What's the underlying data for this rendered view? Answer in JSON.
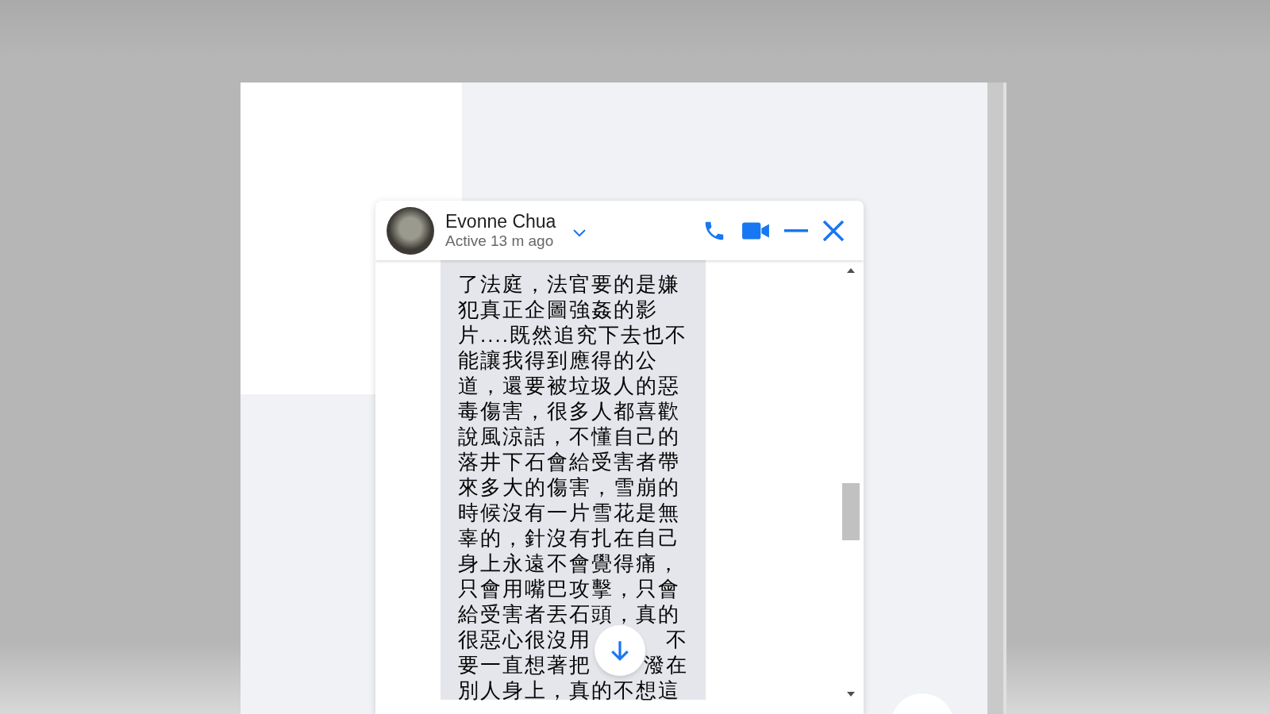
{
  "chat": {
    "contact": {
      "name": "Evonne Chua",
      "status": "Active 13 m ago"
    },
    "message": {
      "lines": [
        [
          "了法庭，法官要的是嫌"
        ],
        [
          "犯真正企圖強姦的影"
        ],
        [
          "片....既然追究下去也不"
        ],
        [
          "能讓我得到應得的公"
        ],
        [
          "道，還要被垃圾人的惡"
        ],
        [
          "毒傷害，很多人都喜歡"
        ],
        [
          "說風涼話，不懂自己的"
        ],
        [
          "落井下石會給受害者帶"
        ],
        [
          "來多大的傷害，雪崩的"
        ],
        [
          "時候沒有一片雪花是無"
        ],
        [
          "辜的，針沒有扎在自己"
        ],
        [
          "身上永遠不會覺得痛，"
        ],
        [
          "只會用嘴巴攻擊，只會"
        ],
        [
          "給受害者丟石頭，真的"
        ],
        [
          "很惡心很沒用",
          "不"
        ],
        [
          "要一直想著把",
          "潑在"
        ],
        [
          "別人身上，真的不想這"
        ]
      ]
    }
  }
}
